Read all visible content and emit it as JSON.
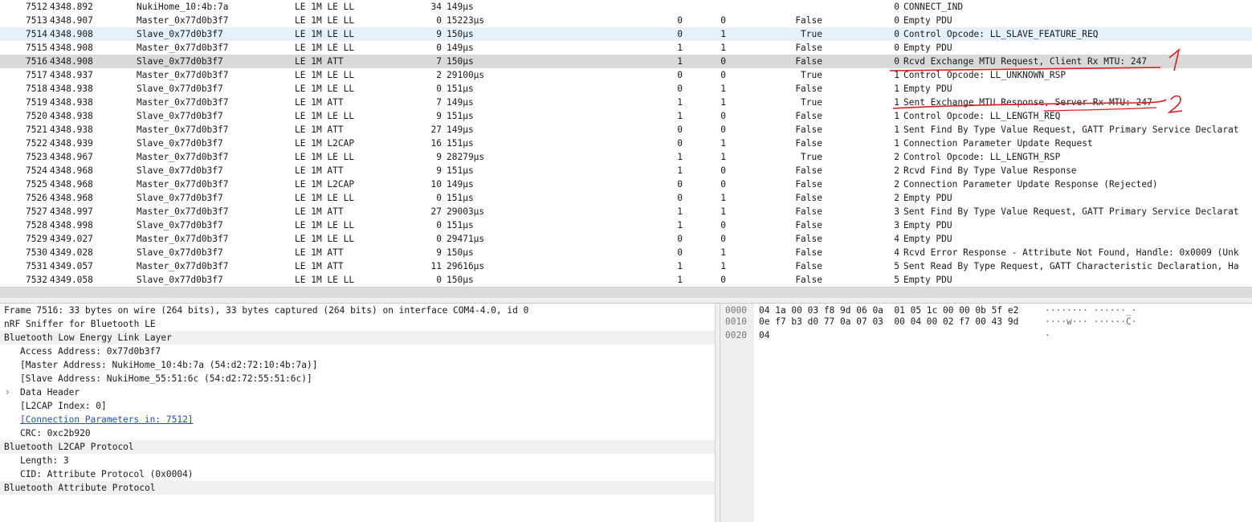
{
  "packets": [
    {
      "no": "7512",
      "time": "4348.892",
      "source": "NukiHome_10:4b:7a",
      "protocol": "LE 1M LE LL",
      "length": "34",
      "delta": "149µs",
      "col_a": "",
      "col_b": "",
      "crc": "",
      "event": "0",
      "info": "CONNECT_IND"
    },
    {
      "no": "7513",
      "time": "4348.907",
      "source": "Master_0x77d0b3f7",
      "protocol": "LE 1M LE LL",
      "length": "0",
      "delta": "15223µs",
      "col_a": "0",
      "col_b": "0",
      "crc": "False",
      "event": "0",
      "info": "Empty PDU"
    },
    {
      "no": "7514",
      "time": "4348.908",
      "source": "Slave_0x77d0b3f7",
      "protocol": "LE 1M LE LL",
      "length": "9",
      "delta": "150µs",
      "col_a": "0",
      "col_b": "1",
      "crc": "True",
      "event": "0",
      "info": "Control Opcode: LL_SLAVE_FEATURE_REQ"
    },
    {
      "no": "7515",
      "time": "4348.908",
      "source": "Master_0x77d0b3f7",
      "protocol": "LE 1M LE LL",
      "length": "0",
      "delta": "149µs",
      "col_a": "1",
      "col_b": "1",
      "crc": "False",
      "event": "0",
      "info": "Empty PDU"
    },
    {
      "no": "7516",
      "time": "4348.908",
      "source": "Slave_0x77d0b3f7",
      "protocol": "LE 1M ATT",
      "length": "7",
      "delta": "150µs",
      "col_a": "1",
      "col_b": "0",
      "crc": "False",
      "event": "0",
      "info": "Rcvd Exchange MTU Request, Client Rx MTU: 247"
    },
    {
      "no": "7517",
      "time": "4348.937",
      "source": "Master_0x77d0b3f7",
      "protocol": "LE 1M LE LL",
      "length": "2",
      "delta": "29100µs",
      "col_a": "0",
      "col_b": "0",
      "crc": "True",
      "event": "1",
      "info": "Control Opcode: LL_UNKNOWN_RSP"
    },
    {
      "no": "7518",
      "time": "4348.938",
      "source": "Slave_0x77d0b3f7",
      "protocol": "LE 1M LE LL",
      "length": "0",
      "delta": "151µs",
      "col_a": "0",
      "col_b": "1",
      "crc": "False",
      "event": "1",
      "info": "Empty PDU"
    },
    {
      "no": "7519",
      "time": "4348.938",
      "source": "Master_0x77d0b3f7",
      "protocol": "LE 1M ATT",
      "length": "7",
      "delta": "149µs",
      "col_a": "1",
      "col_b": "1",
      "crc": "True",
      "event": "1",
      "info": "Sent Exchange MTU Response, Server Rx MTU: 247"
    },
    {
      "no": "7520",
      "time": "4348.938",
      "source": "Slave_0x77d0b3f7",
      "protocol": "LE 1M LE LL",
      "length": "9",
      "delta": "151µs",
      "col_a": "1",
      "col_b": "0",
      "crc": "False",
      "event": "1",
      "info": "Control Opcode: LL_LENGTH_REQ"
    },
    {
      "no": "7521",
      "time": "4348.938",
      "source": "Master_0x77d0b3f7",
      "protocol": "LE 1M ATT",
      "length": "27",
      "delta": "149µs",
      "col_a": "0",
      "col_b": "0",
      "crc": "False",
      "event": "1",
      "info": "Sent Find By Type Value Request, GATT Primary Service Declarat"
    },
    {
      "no": "7522",
      "time": "4348.939",
      "source": "Slave_0x77d0b3f7",
      "protocol": "LE 1M L2CAP",
      "length": "16",
      "delta": "151µs",
      "col_a": "0",
      "col_b": "1",
      "crc": "False",
      "event": "1",
      "info": "Connection Parameter Update Request"
    },
    {
      "no": "7523",
      "time": "4348.967",
      "source": "Master_0x77d0b3f7",
      "protocol": "LE 1M LE LL",
      "length": "9",
      "delta": "28279µs",
      "col_a": "1",
      "col_b": "1",
      "crc": "True",
      "event": "2",
      "info": "Control Opcode: LL_LENGTH_RSP"
    },
    {
      "no": "7524",
      "time": "4348.968",
      "source": "Slave_0x77d0b3f7",
      "protocol": "LE 1M ATT",
      "length": "9",
      "delta": "151µs",
      "col_a": "1",
      "col_b": "0",
      "crc": "False",
      "event": "2",
      "info": "Rcvd Find By Type Value Response"
    },
    {
      "no": "7525",
      "time": "4348.968",
      "source": "Master_0x77d0b3f7",
      "protocol": "LE 1M L2CAP",
      "length": "10",
      "delta": "149µs",
      "col_a": "0",
      "col_b": "0",
      "crc": "False",
      "event": "2",
      "info": "Connection Parameter Update Response (Rejected)"
    },
    {
      "no": "7526",
      "time": "4348.968",
      "source": "Slave_0x77d0b3f7",
      "protocol": "LE 1M LE LL",
      "length": "0",
      "delta": "151µs",
      "col_a": "0",
      "col_b": "1",
      "crc": "False",
      "event": "2",
      "info": "Empty PDU"
    },
    {
      "no": "7527",
      "time": "4348.997",
      "source": "Master_0x77d0b3f7",
      "protocol": "LE 1M ATT",
      "length": "27",
      "delta": "29003µs",
      "col_a": "1",
      "col_b": "1",
      "crc": "False",
      "event": "3",
      "info": "Sent Find By Type Value Request, GATT Primary Service Declarat"
    },
    {
      "no": "7528",
      "time": "4348.998",
      "source": "Slave_0x77d0b3f7",
      "protocol": "LE 1M LE LL",
      "length": "0",
      "delta": "151µs",
      "col_a": "1",
      "col_b": "0",
      "crc": "False",
      "event": "3",
      "info": "Empty PDU"
    },
    {
      "no": "7529",
      "time": "4349.027",
      "source": "Master_0x77d0b3f7",
      "protocol": "LE 1M LE LL",
      "length": "0",
      "delta": "29471µs",
      "col_a": "0",
      "col_b": "0",
      "crc": "False",
      "event": "4",
      "info": "Empty PDU"
    },
    {
      "no": "7530",
      "time": "4349.028",
      "source": "Slave_0x77d0b3f7",
      "protocol": "LE 1M ATT",
      "length": "9",
      "delta": "150µs",
      "col_a": "0",
      "col_b": "1",
      "crc": "False",
      "event": "4",
      "info": "Rcvd Error Response - Attribute Not Found, Handle: 0x0009 (Unk"
    },
    {
      "no": "7531",
      "time": "4349.057",
      "source": "Master_0x77d0b3f7",
      "protocol": "LE 1M ATT",
      "length": "11",
      "delta": "29616µs",
      "col_a": "1",
      "col_b": "1",
      "crc": "False",
      "event": "5",
      "info": "Sent Read By Type Request, GATT Characteristic Declaration, Ha"
    },
    {
      "no": "7532",
      "time": "4349.058",
      "source": "Slave_0x77d0b3f7",
      "protocol": "LE 1M LE LL",
      "length": "0",
      "delta": "150µs",
      "col_a": "1",
      "col_b": "0",
      "crc": "False",
      "event": "5",
      "info": "Empty PDU"
    }
  ],
  "selected_packet": "7516",
  "details": {
    "frame": "Frame 7516: 33 bytes on wire (264 bits), 33 bytes captured (264 bits) on interface COM4-4.0, id 0",
    "nrf": "nRF Sniffer for Bluetooth LE",
    "btle": "Bluetooth Low Energy Link Layer",
    "access_address": "Access Address: 0x77d0b3f7",
    "master_address": "[Master Address: NukiHome_10:4b:7a (54:d2:72:10:4b:7a)]",
    "slave_address": "[Slave Address: NukiHome_55:51:6c (54:d2:72:55:51:6c)]",
    "data_header": "Data Header",
    "l2cap_index": "[L2CAP Index: 0]",
    "conn_params": "[Connection Parameters in: 7512]",
    "crc": "CRC: 0xc2b920",
    "l2cap": "Bluetooth L2CAP Protocol",
    "length": "Length: 3",
    "cid": "CID: Attribute Protocol (0x0004)",
    "att": "Bluetooth Attribute Protocol"
  },
  "hex": [
    {
      "offset": "0000",
      "bytes": "04 1a 00 03 f8 9d 06 0a  01 05 1c 00 00 0b 5f e2",
      "ascii": "········ ······_·"
    },
    {
      "offset": "0010",
      "bytes": "0e f7 b3 d0 77 0a 07 03  00 04 00 02 f7 00 43 9d",
      "ascii": "····w··· ······C·"
    },
    {
      "offset": "0020",
      "bytes": "04",
      "ascii": "·"
    }
  ],
  "annotations": {
    "label_1": "1",
    "label_2": "2",
    "color": "#e21b1b"
  },
  "colors": {
    "selected_row": "#d9d9d9",
    "highlight_row": "#e4f1fb",
    "link": "#1f4fd1",
    "section_shade": "#f0f0f0"
  }
}
